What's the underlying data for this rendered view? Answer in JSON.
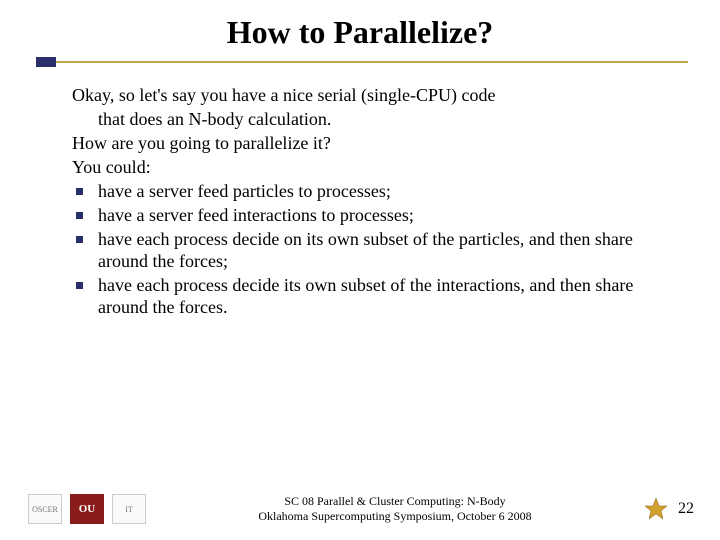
{
  "title": "How to Parallelize?",
  "body": {
    "p1a": "Okay, so let's say you have a nice serial (single-CPU) code",
    "p1b": "that does an N-body calculation.",
    "p2": "How are you going to parallelize it?",
    "p3": "You could:",
    "bullets": [
      "have a server feed particles to processes;",
      "have a server feed interactions to processes;",
      "have each process decide on its own subset of the particles, and then share around the forces;",
      "have each process decide its own subset of the interactions, and then share around the forces."
    ]
  },
  "footer": {
    "logos": [
      "OSCER",
      "OU",
      "IT"
    ],
    "line1": "SC 08 Parallel & Cluster Computing: N-Body",
    "line2": "Oklahoma Supercomputing Symposium, October 6 2008",
    "page": "22"
  }
}
